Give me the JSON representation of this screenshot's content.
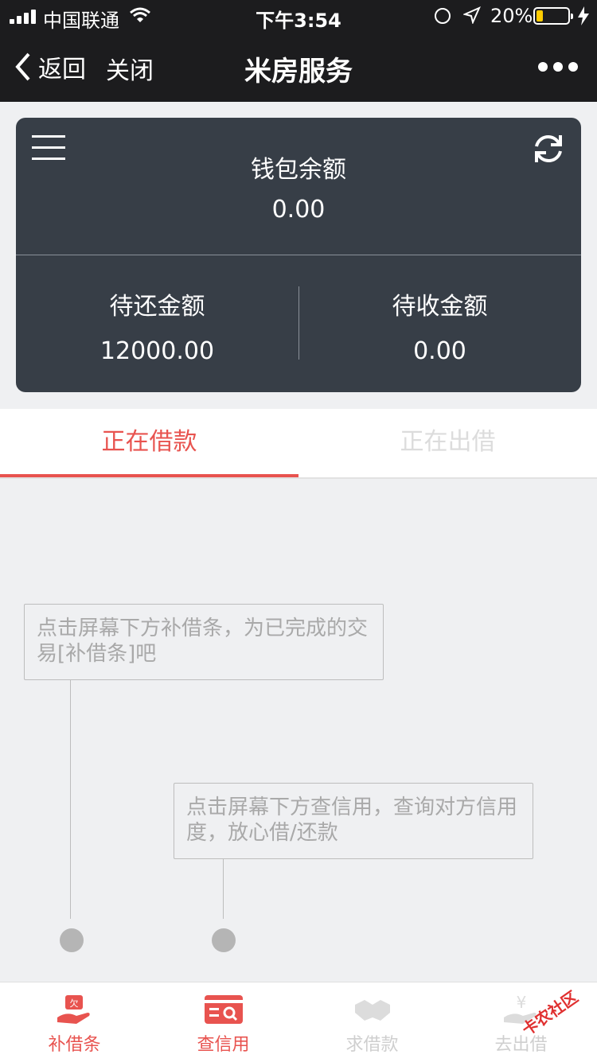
{
  "status_bar": {
    "carrier": "中国联通",
    "time": "下午3:54",
    "battery_percent": "20%",
    "battery_level": 0.2,
    "icons": [
      "signal-icon",
      "wifi-icon",
      "orientation-lock-icon",
      "location-icon",
      "battery-icon",
      "charging-icon"
    ]
  },
  "navbar": {
    "back_label": "返回",
    "close_label": "关闭",
    "title": "米房服务"
  },
  "wallet": {
    "label": "钱包余额",
    "value": "0.00",
    "to_repay_label": "待还金额",
    "to_repay_value": "12000.00",
    "to_collect_label": "待收金额",
    "to_collect_value": "0.00"
  },
  "tabs": [
    {
      "label": "正在借款",
      "active": true
    },
    {
      "label": "正在出借",
      "active": false
    }
  ],
  "tips": [
    "点击屏幕下方补借条，为已完成的交易[补借条]吧",
    "点击屏幕下方查信用，查询对方信用度，放心借/还款"
  ],
  "bottom_bar": [
    {
      "label": "补借条",
      "icon": "iou-icon",
      "active_color": "#e8534f"
    },
    {
      "label": "查信用",
      "icon": "credit-check-icon",
      "active_color": "#e8534f"
    },
    {
      "label": "求借款",
      "icon": "handshake-icon",
      "active_color": "#cfcfcf"
    },
    {
      "label": "去出借",
      "icon": "lend-money-icon",
      "active_color": "#cfcfcf"
    }
  ],
  "watermark": "卡农社区",
  "colors": {
    "accent": "#e8534f",
    "card": "#373e47",
    "header": "#1c1c1e"
  }
}
